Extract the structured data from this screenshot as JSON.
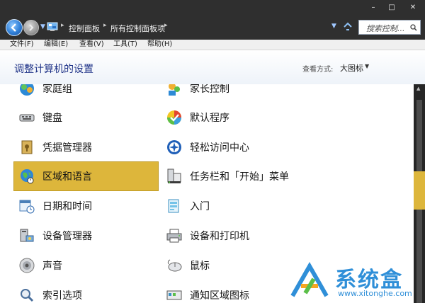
{
  "window": {
    "caption_buttons": [
      "–",
      "□",
      "✕"
    ]
  },
  "address_bar": {
    "breadcrumbs": [
      "控制面板",
      "所有控制面板项"
    ],
    "search_placeholder": "搜索控制..."
  },
  "menu": {
    "items": [
      "文件(F)",
      "编辑(E)",
      "查看(V)",
      "工具(T)",
      "帮助(H)"
    ]
  },
  "header": {
    "title": "调整计算机的设置",
    "view_by_label": "查看方式:",
    "view_by_value": "大图标"
  },
  "left_items": [
    {
      "label": "家庭组",
      "icon": "homegroup-icon"
    },
    {
      "label": "键盘",
      "icon": "keyboard-icon"
    },
    {
      "label": "凭据管理器",
      "icon": "credential-manager-icon"
    },
    {
      "label": "区域和语言",
      "icon": "region-language-icon",
      "selected": true
    },
    {
      "label": "日期和时间",
      "icon": "date-time-icon"
    },
    {
      "label": "设备管理器",
      "icon": "device-manager-icon"
    },
    {
      "label": "声音",
      "icon": "sound-icon"
    },
    {
      "label": "索引选项",
      "icon": "indexing-options-icon"
    }
  ],
  "right_items": [
    {
      "label": "家长控制",
      "icon": "parental-controls-icon"
    },
    {
      "label": "默认程序",
      "icon": "default-programs-icon"
    },
    {
      "label": "轻松访问中心",
      "icon": "ease-of-access-icon"
    },
    {
      "label": "任务栏和「开始」菜单",
      "icon": "taskbar-start-menu-icon"
    },
    {
      "label": "入门",
      "icon": "getting-started-icon"
    },
    {
      "label": "设备和打印机",
      "icon": "devices-printers-icon"
    },
    {
      "label": "鼠标",
      "icon": "mouse-icon"
    },
    {
      "label": "通知区域图标",
      "icon": "notification-area-icon"
    }
  ],
  "watermark": {
    "title": "系统盒",
    "url": "www.xitonghe.com"
  },
  "colors": {
    "selection": "#ddb63b",
    "title_blue": "#1e3287",
    "chrome_dark": "#2f2f2f"
  }
}
